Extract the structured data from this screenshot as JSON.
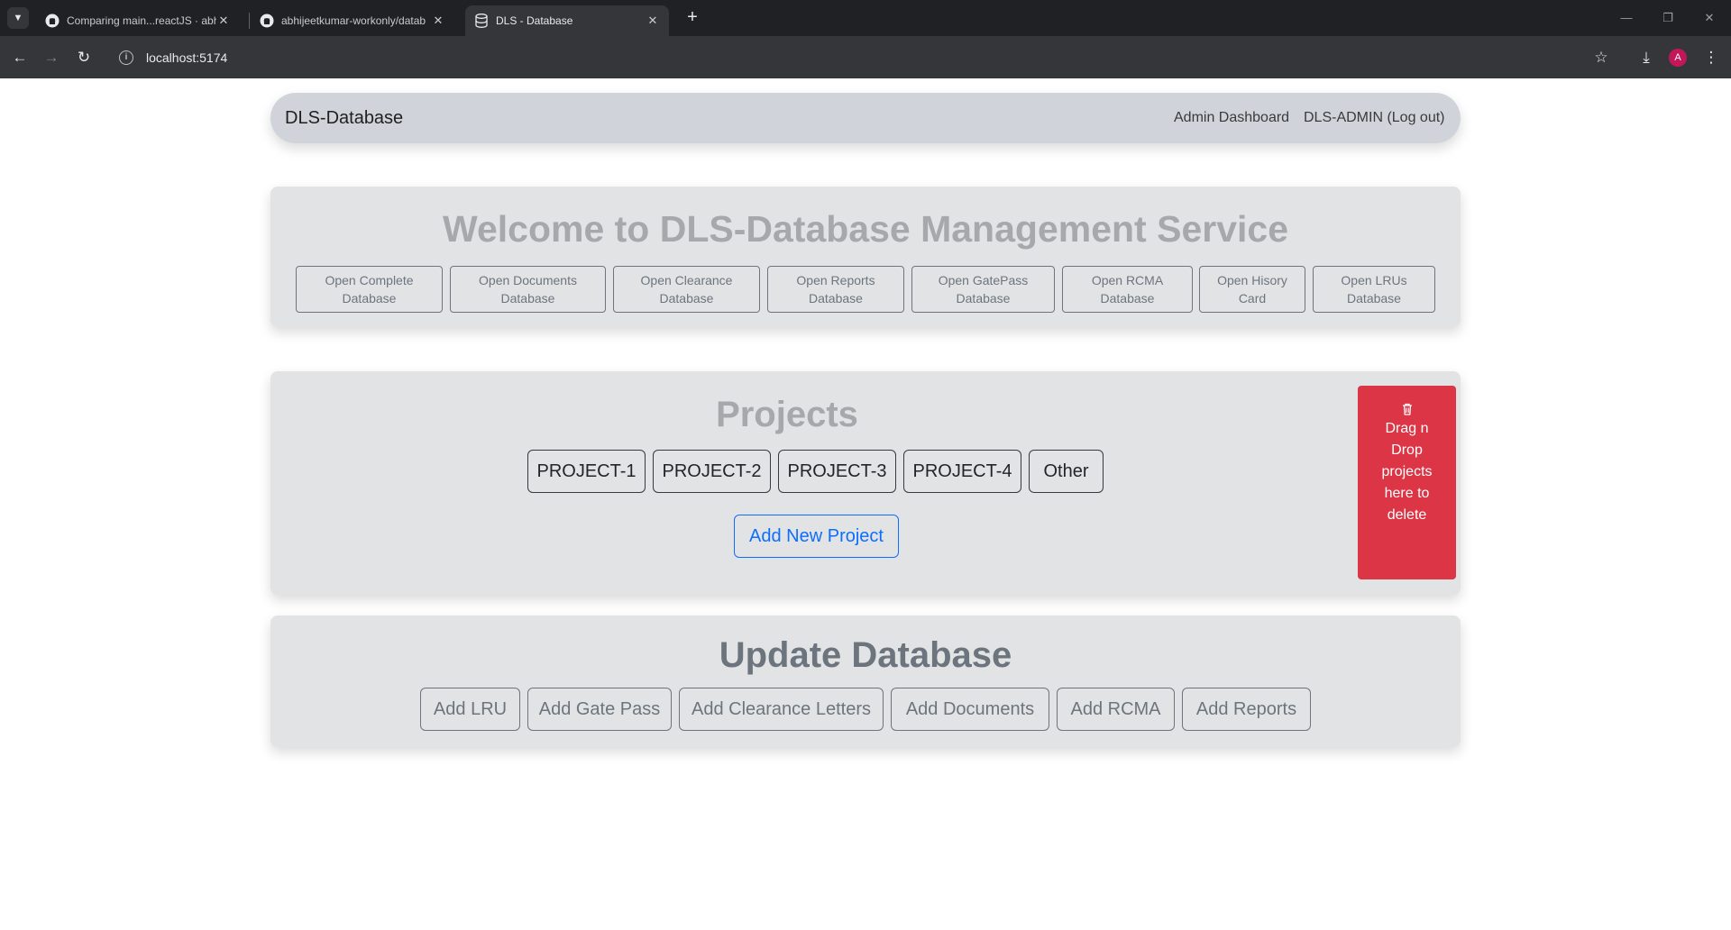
{
  "browser": {
    "tabs": [
      {
        "title": "Comparing main...reactJS · abhi",
        "active": false
      },
      {
        "title": "abhijeetkumar-workonly/datab",
        "active": false
      },
      {
        "title": "DLS - Database",
        "active": true
      }
    ],
    "url": "localhost:5174",
    "avatar_letter": "A"
  },
  "navbar": {
    "brand": "DLS-Database",
    "links": [
      "Admin Dashboard",
      "DLS-ADMIN (Log out)"
    ]
  },
  "welcome": {
    "title": "Welcome to DLS-Database Management Service",
    "buttons": [
      {
        "line1": "Open Complete",
        "line2": "Database"
      },
      {
        "line1": "Open Documents",
        "line2": "Database"
      },
      {
        "line1": "Open Clearance",
        "line2": "Database"
      },
      {
        "line1": "Open Reports",
        "line2": "Database"
      },
      {
        "line1": "Open GatePass",
        "line2": "Database"
      },
      {
        "line1": "Open RCMA",
        "line2": "Database"
      },
      {
        "line1": "Open Hisory",
        "line2": "Card"
      },
      {
        "line1": "Open LRUs",
        "line2": "Database"
      }
    ]
  },
  "projects": {
    "title": "Projects",
    "items": [
      "PROJECT-1",
      "PROJECT-2",
      "PROJECT-3",
      "PROJECT-4",
      "Other"
    ],
    "add_label": "Add New Project",
    "delete_zone": {
      "lines": [
        "Drag n",
        "Drop",
        "projects",
        "here to",
        "delete"
      ]
    }
  },
  "update": {
    "title": "Update Database",
    "buttons": [
      "Add LRU",
      "Add Gate Pass",
      "Add Clearance Letters",
      "Add Documents",
      "Add RCMA",
      "Add Reports"
    ]
  },
  "colors": {
    "danger": "#dc3545",
    "primary": "#0d6efd",
    "secondary": "#6c757d"
  }
}
